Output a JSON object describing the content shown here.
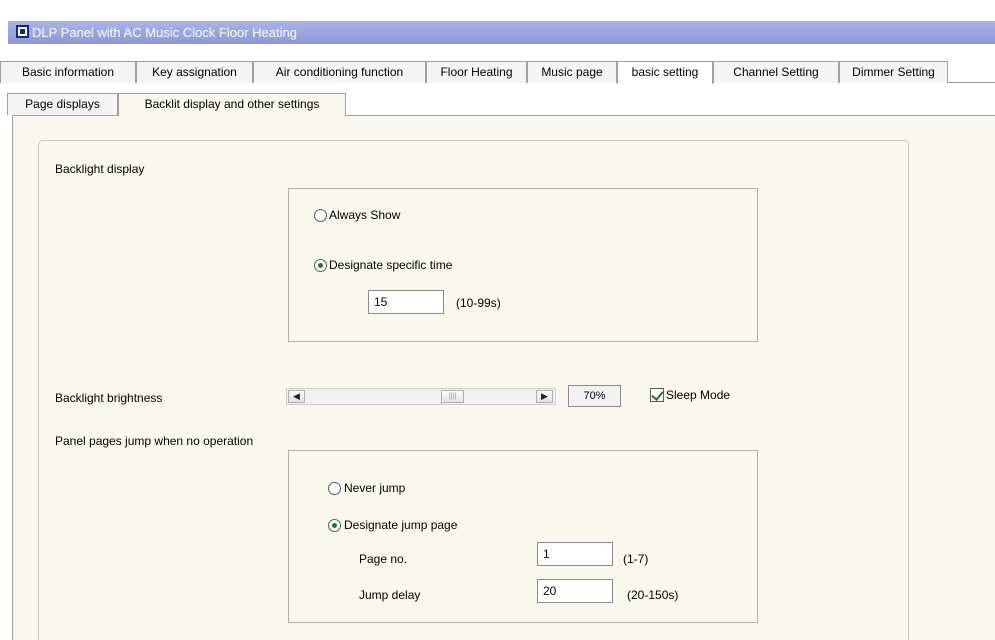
{
  "window": {
    "title": "DLP Panel with AC Music Clock Floor Heating"
  },
  "main_tabs": [
    {
      "label": "Basic information"
    },
    {
      "label": "Key assignation"
    },
    {
      "label": "Air conditioning function"
    },
    {
      "label": "Floor Heating"
    },
    {
      "label": "Music page"
    },
    {
      "label": "basic setting"
    },
    {
      "label": "Channel Setting"
    },
    {
      "label": "Dimmer Setting"
    }
  ],
  "active_main_tab": "basic setting",
  "sub_tabs": [
    {
      "label": "Page displays"
    },
    {
      "label": "Backlit display and other settings"
    }
  ],
  "active_sub_tab": "Backlit display and other settings",
  "backlight_display": {
    "label": "Backlight display",
    "option_always": "Always Show",
    "option_specific": "Designate specific time",
    "selected": "Designate specific time",
    "time_value": "15",
    "time_range": "(10-99s)"
  },
  "backlight_brightness": {
    "label": "Backlight brightness",
    "percent": "70%",
    "level": 0.7,
    "sleep_mode_label": "Sleep Mode",
    "sleep_mode_checked": true
  },
  "panel_jump": {
    "label": "Panel pages jump when no operation",
    "option_never": "Never jump",
    "option_designate": "Designate jump page",
    "selected": "Designate jump page",
    "page_no_label": "Page no.",
    "page_no_value": "1",
    "page_no_range": "(1-7)",
    "jump_delay_label": "Jump delay",
    "jump_delay_value": "20",
    "jump_delay_range": "(20-150s)"
  },
  "icons": {
    "app": "app-window-icon",
    "scroll_left": "scroll-left-icon",
    "scroll_right": "scroll-right-icon",
    "scroll_grip": "scroll-grip-icon"
  },
  "colors": {
    "title_bar": "#8c97d6",
    "panel_bg": "#faf7ec",
    "check_green": "#1e7a1e"
  }
}
